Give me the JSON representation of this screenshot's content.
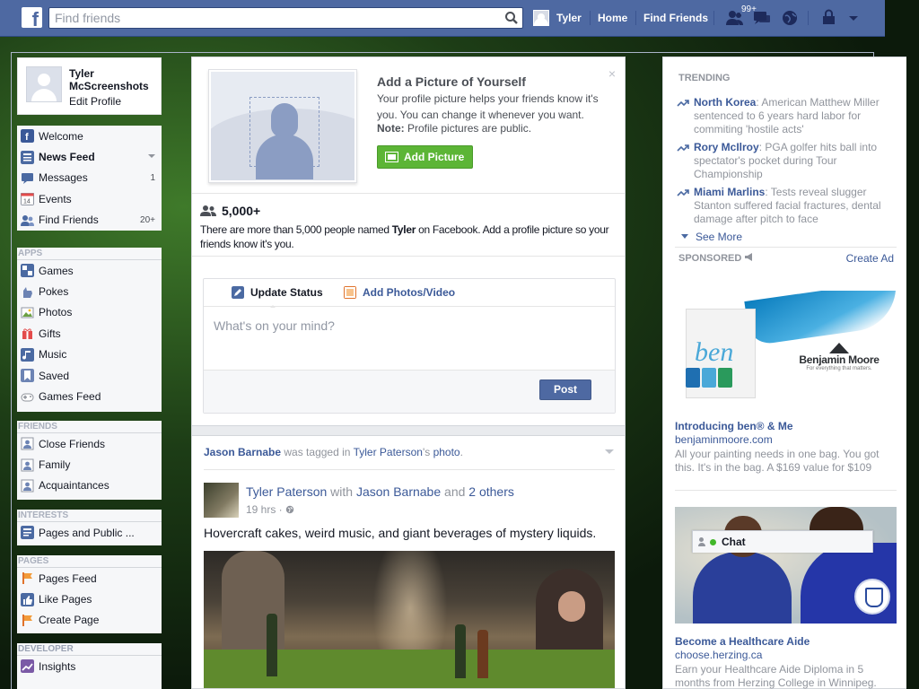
{
  "topbar": {
    "logo": "f",
    "search_placeholder": "Find friends",
    "user_name": "Tyler",
    "home": "Home",
    "find_friends": "Find Friends",
    "friend_requests_badge": "99+",
    "brand_color": "#4e69a2"
  },
  "sidebar": {
    "profile": {
      "name": "Tyler McScreenshots",
      "edit": "Edit Profile"
    },
    "favorites": [
      {
        "label": "Welcome",
        "icon": "welcome-icon",
        "count": ""
      },
      {
        "label": "News Feed",
        "icon": "news-feed-icon",
        "count": ""
      },
      {
        "label": "Messages",
        "icon": "messages-icon",
        "count": "1"
      },
      {
        "label": "Events",
        "icon": "events-icon",
        "count": ""
      },
      {
        "label": "Find Friends",
        "icon": "find-friends-icon",
        "count": "20+"
      }
    ],
    "events_icon_text": "14",
    "apps_header": "APPS",
    "apps": [
      {
        "label": "Games",
        "icon": "games-icon"
      },
      {
        "label": "Pokes",
        "icon": "pokes-icon"
      },
      {
        "label": "Photos",
        "icon": "photos-icon"
      },
      {
        "label": "Gifts",
        "icon": "gifts-icon"
      },
      {
        "label": "Music",
        "icon": "music-icon"
      },
      {
        "label": "Saved",
        "icon": "saved-icon"
      },
      {
        "label": "Games Feed",
        "icon": "games-feed-icon"
      }
    ],
    "friends_header": "FRIENDS",
    "friends": [
      {
        "label": "Close Friends",
        "icon": "close-friends-icon"
      },
      {
        "label": "Family",
        "icon": "family-icon"
      },
      {
        "label": "Acquaintances",
        "icon": "acquaintances-icon"
      }
    ],
    "interests_header": "INTERESTS",
    "interests": [
      {
        "label": "Pages and Public ...",
        "icon": "pages-public-icon"
      }
    ],
    "pages_header": "PAGES",
    "pages": [
      {
        "label": "Pages Feed",
        "icon": "pages-feed-icon"
      },
      {
        "label": "Like Pages",
        "icon": "like-pages-icon"
      },
      {
        "label": "Create Page",
        "icon": "create-page-icon"
      }
    ],
    "developer_header": "DEVELOPER",
    "developer": [
      {
        "label": "Insights",
        "icon": "insights-icon"
      }
    ]
  },
  "profile_prompt": {
    "title": "Add a Picture of Yourself",
    "text": "Your profile picture helps your friends know it's you. You can change it whenever you want.",
    "note_label": "Note:",
    "note_text": " Profile pictures are public.",
    "button": "Add Picture",
    "close": "×"
  },
  "people": {
    "count": "5,000+",
    "text_pre": "There are more than 5,000 people named ",
    "name": "Tyler",
    "text_post": " on Facebook. Add a profile picture so your friends know it's you."
  },
  "composer": {
    "tab_status": "Update Status",
    "tab_photo": "Add Photos/Video",
    "placeholder": "What's on your mind?",
    "post_button": "Post"
  },
  "story": {
    "context_name": "Jason Barnabe",
    "context_mid": " was tagged in ",
    "context_owner": "Tyler Paterson",
    "context_suffix": "'s ",
    "context_link": "photo",
    "context_end": ".",
    "author": "Tyler Paterson",
    "with": " with ",
    "tagged": "Jason Barnabe",
    "and": " and ",
    "others": "2 others",
    "time": "19 hrs · ",
    "text": "Hovercraft cakes, weird music, and giant beverages of mystery liquids."
  },
  "right": {
    "trending_header": "TRENDING",
    "trending": [
      {
        "topic": "North Korea",
        "desc": ": American Matthew Miller sentenced to 6 years hard labor for commiting 'hostile acts'"
      },
      {
        "topic": "Rory McIlroy",
        "desc": ": PGA golfer hits ball into spectator's pocket during Tour Championship"
      },
      {
        "topic": "Miami Marlins",
        "desc": ": Tests reveal slugger Stanton suffered facial fractures, dental damage after pitch to face"
      }
    ],
    "see_more": "See More",
    "sponsored": "SPONSORED",
    "create_ad": "Create Ad",
    "ad1": {
      "bag_text": "ben",
      "brand": "Benjamin Moore",
      "tagline": "For everything that matters.",
      "title": "Introducing ben® & Me",
      "url": "benjaminmoore.com",
      "desc": "All your painting needs in one bag. You got this. It's in the bag. A $169 value for $109"
    },
    "ad2": {
      "title": "Become a Healthcare Aide",
      "url": "choose.herzing.ca",
      "desc": "Earn your Healthcare Aide Diploma in 5 months from Herzing College in Winnipeg."
    }
  },
  "chat": {
    "label": "Chat"
  }
}
